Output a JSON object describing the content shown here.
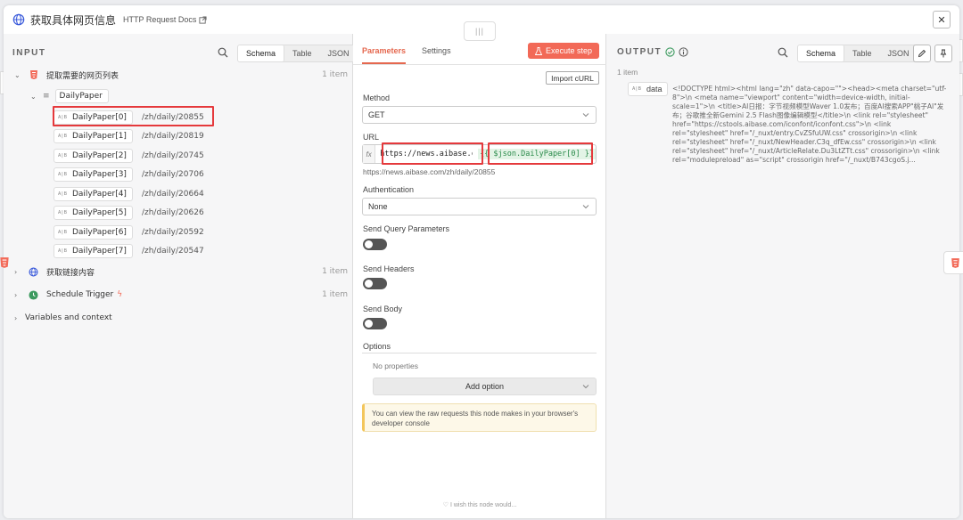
{
  "header": {
    "title": "获取具体网页信息",
    "docs_link": "HTTP Request Docs",
    "close_glyph": "✕",
    "drag_glyph": "|||"
  },
  "input": {
    "heading": "INPUT",
    "view_tabs": [
      "Schema",
      "Table",
      "JSON"
    ],
    "nodes": [
      {
        "label": "提取需要的网页列表",
        "count": "1 item",
        "field": "DailyPaper",
        "items": [
          {
            "key": "DailyPaper[0]",
            "value": "/zh/daily/20855"
          },
          {
            "key": "DailyPaper[1]",
            "value": "/zh/daily/20819"
          },
          {
            "key": "DailyPaper[2]",
            "value": "/zh/daily/20745"
          },
          {
            "key": "DailyPaper[3]",
            "value": "/zh/daily/20706"
          },
          {
            "key": "DailyPaper[4]",
            "value": "/zh/daily/20664"
          },
          {
            "key": "DailyPaper[5]",
            "value": "/zh/daily/20626"
          },
          {
            "key": "DailyPaper[6]",
            "value": "/zh/daily/20592"
          },
          {
            "key": "DailyPaper[7]",
            "value": "/zh/daily/20547"
          }
        ]
      },
      {
        "label": "获取链接内容",
        "count": "1 item"
      },
      {
        "label": "Schedule Trigger",
        "count": "1 item"
      }
    ],
    "vars_label": "Variables and context",
    "type_tag": "A|B"
  },
  "params": {
    "tab_parameters": "Parameters",
    "tab_settings": "Settings",
    "execute_label": "Execute step",
    "import_curl": "Import cURL",
    "method_label": "Method",
    "method_value": "GET",
    "url_label": "URL",
    "fx_label": "fx",
    "url_static": "https://news.aibase.com",
    "url_expression": "{{ $json.DailyPaper[0] }}",
    "url_resolved": "https://news.aibase.com/zh/daily/20855",
    "auth_label": "Authentication",
    "auth_value": "None",
    "query_label": "Send Query Parameters",
    "headers_label": "Send Headers",
    "body_label": "Send Body",
    "options_label": "Options",
    "no_properties": "No properties",
    "add_option": "Add option",
    "notice": "You can view the raw requests this node makes in your browser's developer console",
    "wish": "I wish this node would..."
  },
  "output": {
    "heading": "OUTPUT",
    "view_tabs": [
      "Schema",
      "Table",
      "JSON"
    ],
    "count": "1 item",
    "data_key": "data",
    "data_value": "<!DOCTYPE html><html lang=\"zh\" data-capo=\"\"><head><meta charset=\"utf-8\">\\n <meta name=\"viewport\" content=\"width=device-width, initial-scale=1\">\\n <title>AI日报：字节视频模型Waver 1.0发布；百度AI搜索APP\"桃子AI\"发布；谷歌推全新Gemini 2.5 Flash图像编辑模型</title>\\n <link rel=\"stylesheet\" href=\"https://cstools.aibase.com/iconfont/iconfont.css\">\\n <link rel=\"stylesheet\" href=\"/_nuxt/entry.CvZSfuUW.css\" crossorigin>\\n <link rel=\"stylesheet\" href=\"/_nuxt/NewHeader.C3q_dfEw.css\" crossorigin>\\n <link rel=\"stylesheet\" href=\"/_nuxt/ArticleRelate.Du3LtZTt.css\" crossorigin>\\n <link rel=\"modulepreload\" as=\"script\" crossorigin href=\"/_nuxt/B743cgoS.j..."
  },
  "colors": {
    "accent": "#f26957",
    "highlight_border": "#e5393c",
    "success": "#3c9a5f"
  }
}
